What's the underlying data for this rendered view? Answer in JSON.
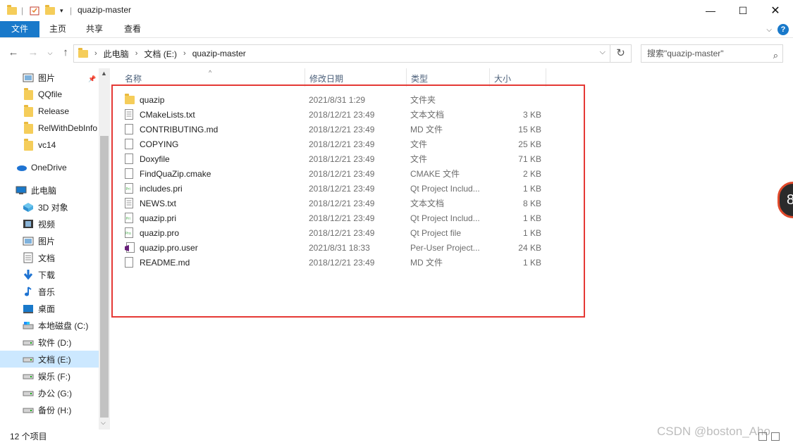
{
  "window": {
    "title": "quazip-master"
  },
  "ribbon": {
    "tabs": [
      "文件",
      "主页",
      "共享",
      "查看"
    ],
    "help": "?"
  },
  "address": {
    "crumbs": [
      "此电脑",
      "文档 (E:)",
      "quazip-master"
    ]
  },
  "search": {
    "placeholder": "搜索\"quazip-master\""
  },
  "sidebar": {
    "items": [
      {
        "label": "图片",
        "icon": "pictures-icon"
      },
      {
        "label": "QQfile",
        "icon": "folder-icon"
      },
      {
        "label": "Release",
        "icon": "folder-icon"
      },
      {
        "label": "RelWithDebInfo",
        "icon": "folder-icon"
      },
      {
        "label": "vc14",
        "icon": "folder-icon"
      },
      {
        "label": "OneDrive",
        "icon": "onedrive-icon"
      },
      {
        "label": "此电脑",
        "icon": "this-pc-icon"
      },
      {
        "label": "3D 对象",
        "icon": "3d-objects-icon"
      },
      {
        "label": "视频",
        "icon": "videos-icon"
      },
      {
        "label": "图片",
        "icon": "pictures-icon"
      },
      {
        "label": "文档",
        "icon": "documents-icon"
      },
      {
        "label": "下载",
        "icon": "downloads-icon"
      },
      {
        "label": "音乐",
        "icon": "music-icon"
      },
      {
        "label": "桌面",
        "icon": "desktop-icon"
      },
      {
        "label": "本地磁盘 (C:)",
        "icon": "system-drive-icon"
      },
      {
        "label": "软件 (D:)",
        "icon": "drive-icon"
      },
      {
        "label": "文档 (E:)",
        "icon": "drive-icon"
      },
      {
        "label": "娱乐 (F:)",
        "icon": "drive-icon"
      },
      {
        "label": "办公 (G:)",
        "icon": "drive-icon"
      },
      {
        "label": "备份 (H:)",
        "icon": "drive-icon"
      }
    ]
  },
  "columns": [
    "名称",
    "修改日期",
    "类型",
    "大小"
  ],
  "files": [
    {
      "name": "quazip",
      "date": "2021/8/31 1:29",
      "type": "文件夹",
      "size": "",
      "icon": "folder-icon"
    },
    {
      "name": "CMakeLists.txt",
      "date": "2018/12/21 23:49",
      "type": "文本文档",
      "size": "3 KB",
      "icon": "text-file-icon"
    },
    {
      "name": "CONTRIBUTING.md",
      "date": "2018/12/21 23:49",
      "type": "MD 文件",
      "size": "15 KB",
      "icon": "file-icon"
    },
    {
      "name": "COPYING",
      "date": "2018/12/21 23:49",
      "type": "文件",
      "size": "25 KB",
      "icon": "file-icon"
    },
    {
      "name": "Doxyfile",
      "date": "2018/12/21 23:49",
      "type": "文件",
      "size": "71 KB",
      "icon": "file-icon"
    },
    {
      "name": "FindQuaZip.cmake",
      "date": "2018/12/21 23:49",
      "type": "CMAKE 文件",
      "size": "2 KB",
      "icon": "file-icon"
    },
    {
      "name": "includes.pri",
      "date": "2018/12/21 23:49",
      "type": "Qt Project Includ...",
      "size": "1 KB",
      "icon": "qt-pri-icon"
    },
    {
      "name": "NEWS.txt",
      "date": "2018/12/21 23:49",
      "type": "文本文档",
      "size": "8 KB",
      "icon": "text-file-icon"
    },
    {
      "name": "quazip.pri",
      "date": "2018/12/21 23:49",
      "type": "Qt Project Includ...",
      "size": "1 KB",
      "icon": "qt-pri-icon"
    },
    {
      "name": "quazip.pro",
      "date": "2018/12/21 23:49",
      "type": "Qt Project file",
      "size": "1 KB",
      "icon": "qt-pro-icon"
    },
    {
      "name": "quazip.pro.user",
      "date": "2021/8/31 18:33",
      "type": "Per-User Project...",
      "size": "24 KB",
      "icon": "vs-user-icon"
    },
    {
      "name": "README.md",
      "date": "2018/12/21 23:49",
      "type": "MD 文件",
      "size": "1 KB",
      "icon": "file-icon"
    }
  ],
  "status": {
    "count": "12 个项目"
  },
  "watermark": "CSDN @boston_Aho",
  "badge": "8",
  "colors": {
    "accent": "#1979ca",
    "selection": "#cce8ff",
    "highlight": "#e53935",
    "folder": "#f5cd5a"
  }
}
